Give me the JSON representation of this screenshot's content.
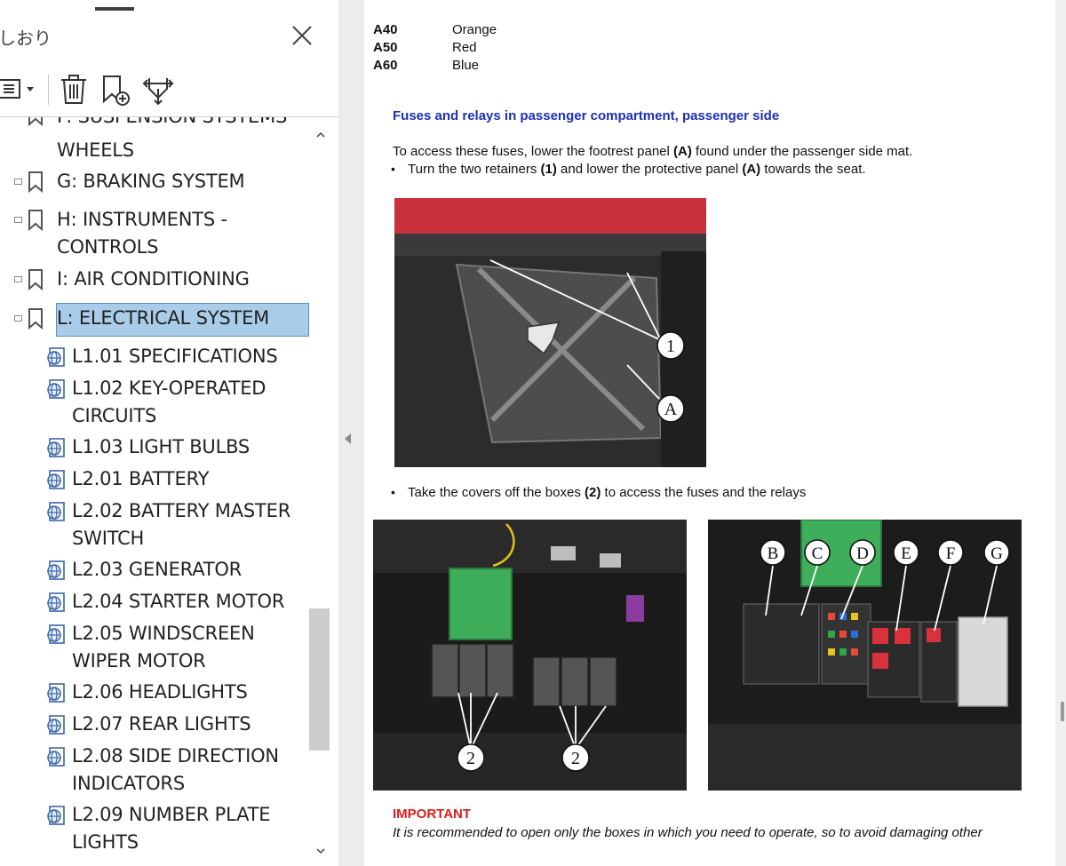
{
  "sidebar": {
    "title": "しおり",
    "close_icon": "close-icon",
    "toolbar": {
      "options_icon": "options-menu-icon",
      "delete_icon": "trash-icon",
      "new_bookmark_icon": "new-bookmark-icon",
      "expand_icon": "expand-bookmark-icon"
    },
    "items": [
      {
        "label": "F: SUSPENSION SYSTEMS",
        "level": 1
      },
      {
        "label": "WHEELS",
        "level": 1
      },
      {
        "label": "G: BRAKING SYSTEM",
        "level": 1
      },
      {
        "label": "H: INSTRUMENTS -",
        "level": 1
      },
      {
        "label": "CONTROLS",
        "level": 1
      },
      {
        "label": "I: AIR CONDITIONING",
        "level": 1
      },
      {
        "label": "L: ELECTRICAL SYSTEM",
        "level": 1,
        "selected": true
      },
      {
        "label": "L1.01 SPECIFICATIONS",
        "level": 2
      },
      {
        "label": "L1.02 KEY-OPERATED",
        "level": 2
      },
      {
        "label": "CIRCUITS",
        "level": 2
      },
      {
        "label": "L1.03 LIGHT BULBS",
        "level": 2
      },
      {
        "label": "L2.01 BATTERY",
        "level": 2
      },
      {
        "label": "L2.02 BATTERY MASTER",
        "level": 2
      },
      {
        "label": "SWITCH",
        "level": 2
      },
      {
        "label": "L2.03 GENERATOR",
        "level": 2
      },
      {
        "label": "L2.04 STARTER MOTOR",
        "level": 2
      },
      {
        "label": "L2.05 WINDSCREEN",
        "level": 2
      },
      {
        "label": "WIPER MOTOR",
        "level": 2
      },
      {
        "label": "L2.06 HEADLIGHTS",
        "level": 2
      },
      {
        "label": "L2.07 REAR LIGHTS",
        "level": 2
      },
      {
        "label": "L2.08 SIDE DIRECTION",
        "level": 2
      },
      {
        "label": "INDICATORS",
        "level": 2
      },
      {
        "label": "L2.09 NUMBER PLATE",
        "level": 2
      },
      {
        "label": "LIGHTS",
        "level": 2
      }
    ]
  },
  "doc": {
    "fuse_colors": [
      {
        "code": "A40",
        "color": "Orange"
      },
      {
        "code": "A50",
        "color": "Red"
      },
      {
        "code": "A60",
        "color": "Blue"
      }
    ],
    "section_title": "Fuses and relays in passenger compartment, passenger side",
    "para1": {
      "pre": "To access these fuses, lower the footrest panel ",
      "b1": "(A)",
      "post": " found under the passenger side mat."
    },
    "bullet1": {
      "pre": "Turn the two retainers ",
      "b1": "(1)",
      "mid": " and lower the protective panel ",
      "b2": "(A)",
      "post": " towards the seat."
    },
    "bullet2": {
      "pre": "Take the covers off the boxes ",
      "b1": "(2)",
      "post": " to access the fuses and the relays"
    },
    "bullet_char": "•",
    "photo1_callouts": [
      "1",
      "A"
    ],
    "photo2_callouts": [
      "2",
      "2"
    ],
    "photo3_callouts": [
      "B",
      "C",
      "D",
      "E",
      "F",
      "G"
    ],
    "important_label": "IMPORTANT",
    "important_text": "It is recommended to open only the boxes in which you need to operate, so to avoid damaging other"
  },
  "colors": {
    "section_title": "#1e2fb4",
    "important": "#e01b1b",
    "selection": "#a9cde8"
  }
}
